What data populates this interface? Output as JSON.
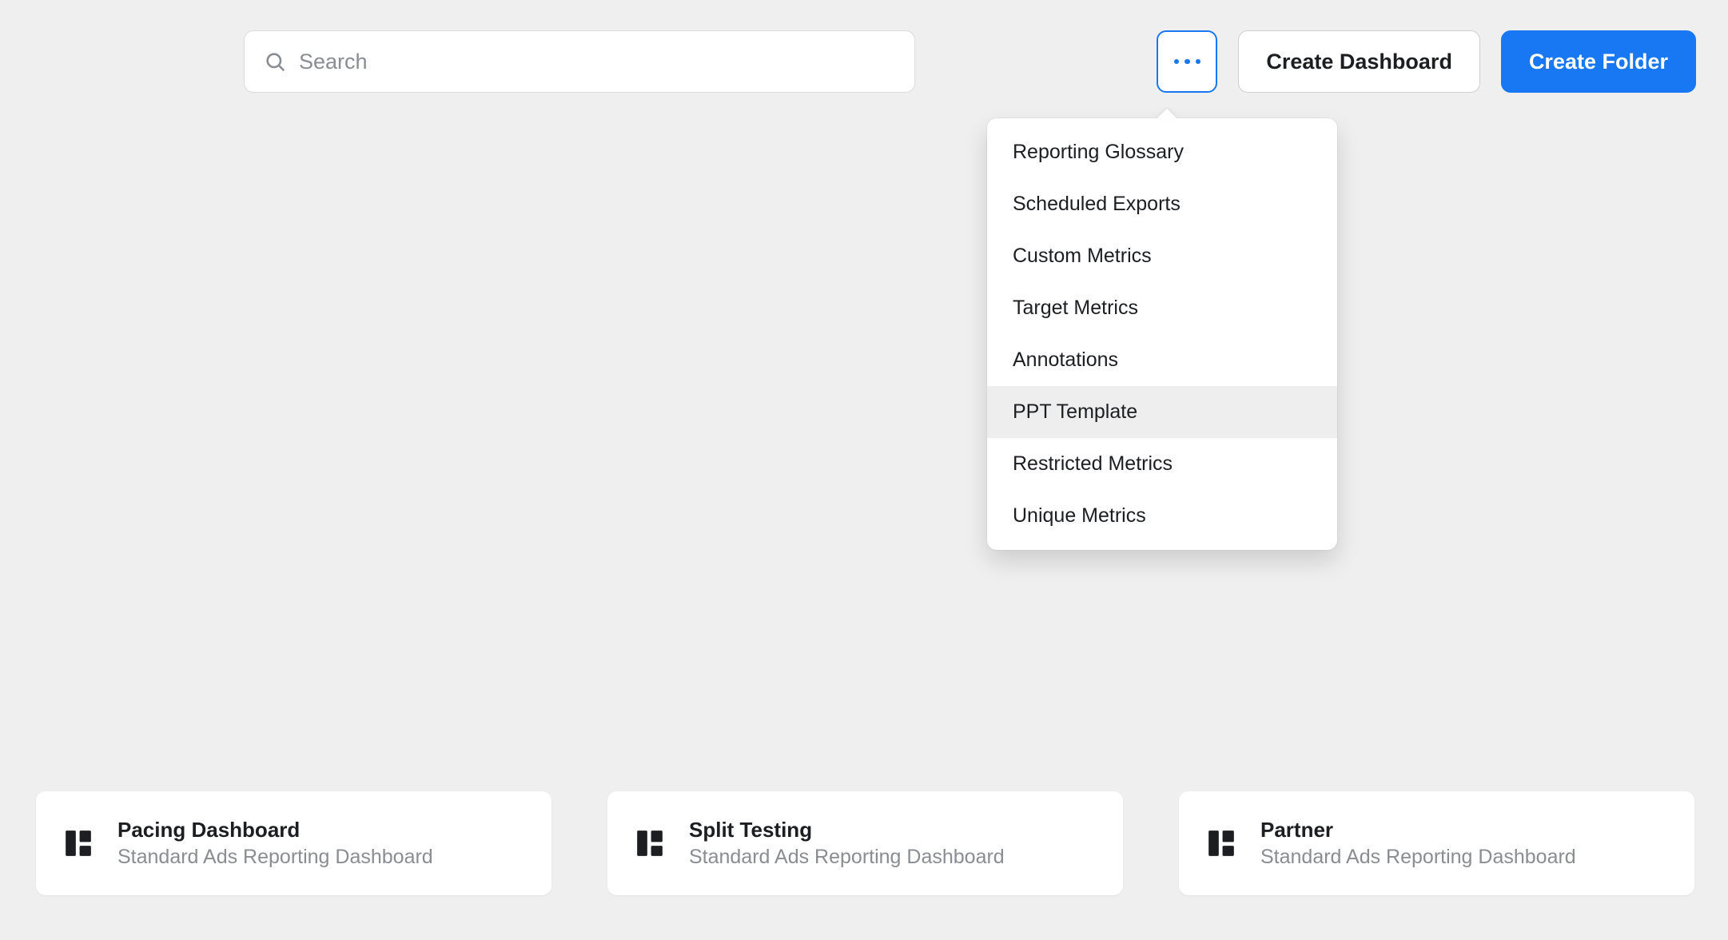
{
  "search": {
    "placeholder": "Search",
    "value": ""
  },
  "toolbar": {
    "create_dashboard_label": "Create Dashboard",
    "create_folder_label": "Create Folder"
  },
  "more_menu": {
    "items": [
      {
        "label": "Reporting Glossary",
        "hovered": false
      },
      {
        "label": "Scheduled Exports",
        "hovered": false
      },
      {
        "label": "Custom Metrics",
        "hovered": false
      },
      {
        "label": "Target Metrics",
        "hovered": false
      },
      {
        "label": "Annotations",
        "hovered": false
      },
      {
        "label": "PPT Template",
        "hovered": true
      },
      {
        "label": "Restricted Metrics",
        "hovered": false
      },
      {
        "label": "Unique Metrics",
        "hovered": false
      }
    ]
  },
  "cards": [
    {
      "title": "Pacing Dashboard",
      "subtitle": "Standard Ads Reporting Dashboard"
    },
    {
      "title": "Split Testing",
      "subtitle": "Standard Ads Reporting Dashboard"
    },
    {
      "title": "Partner",
      "subtitle": "Standard Ads Reporting Dashboard"
    }
  ]
}
